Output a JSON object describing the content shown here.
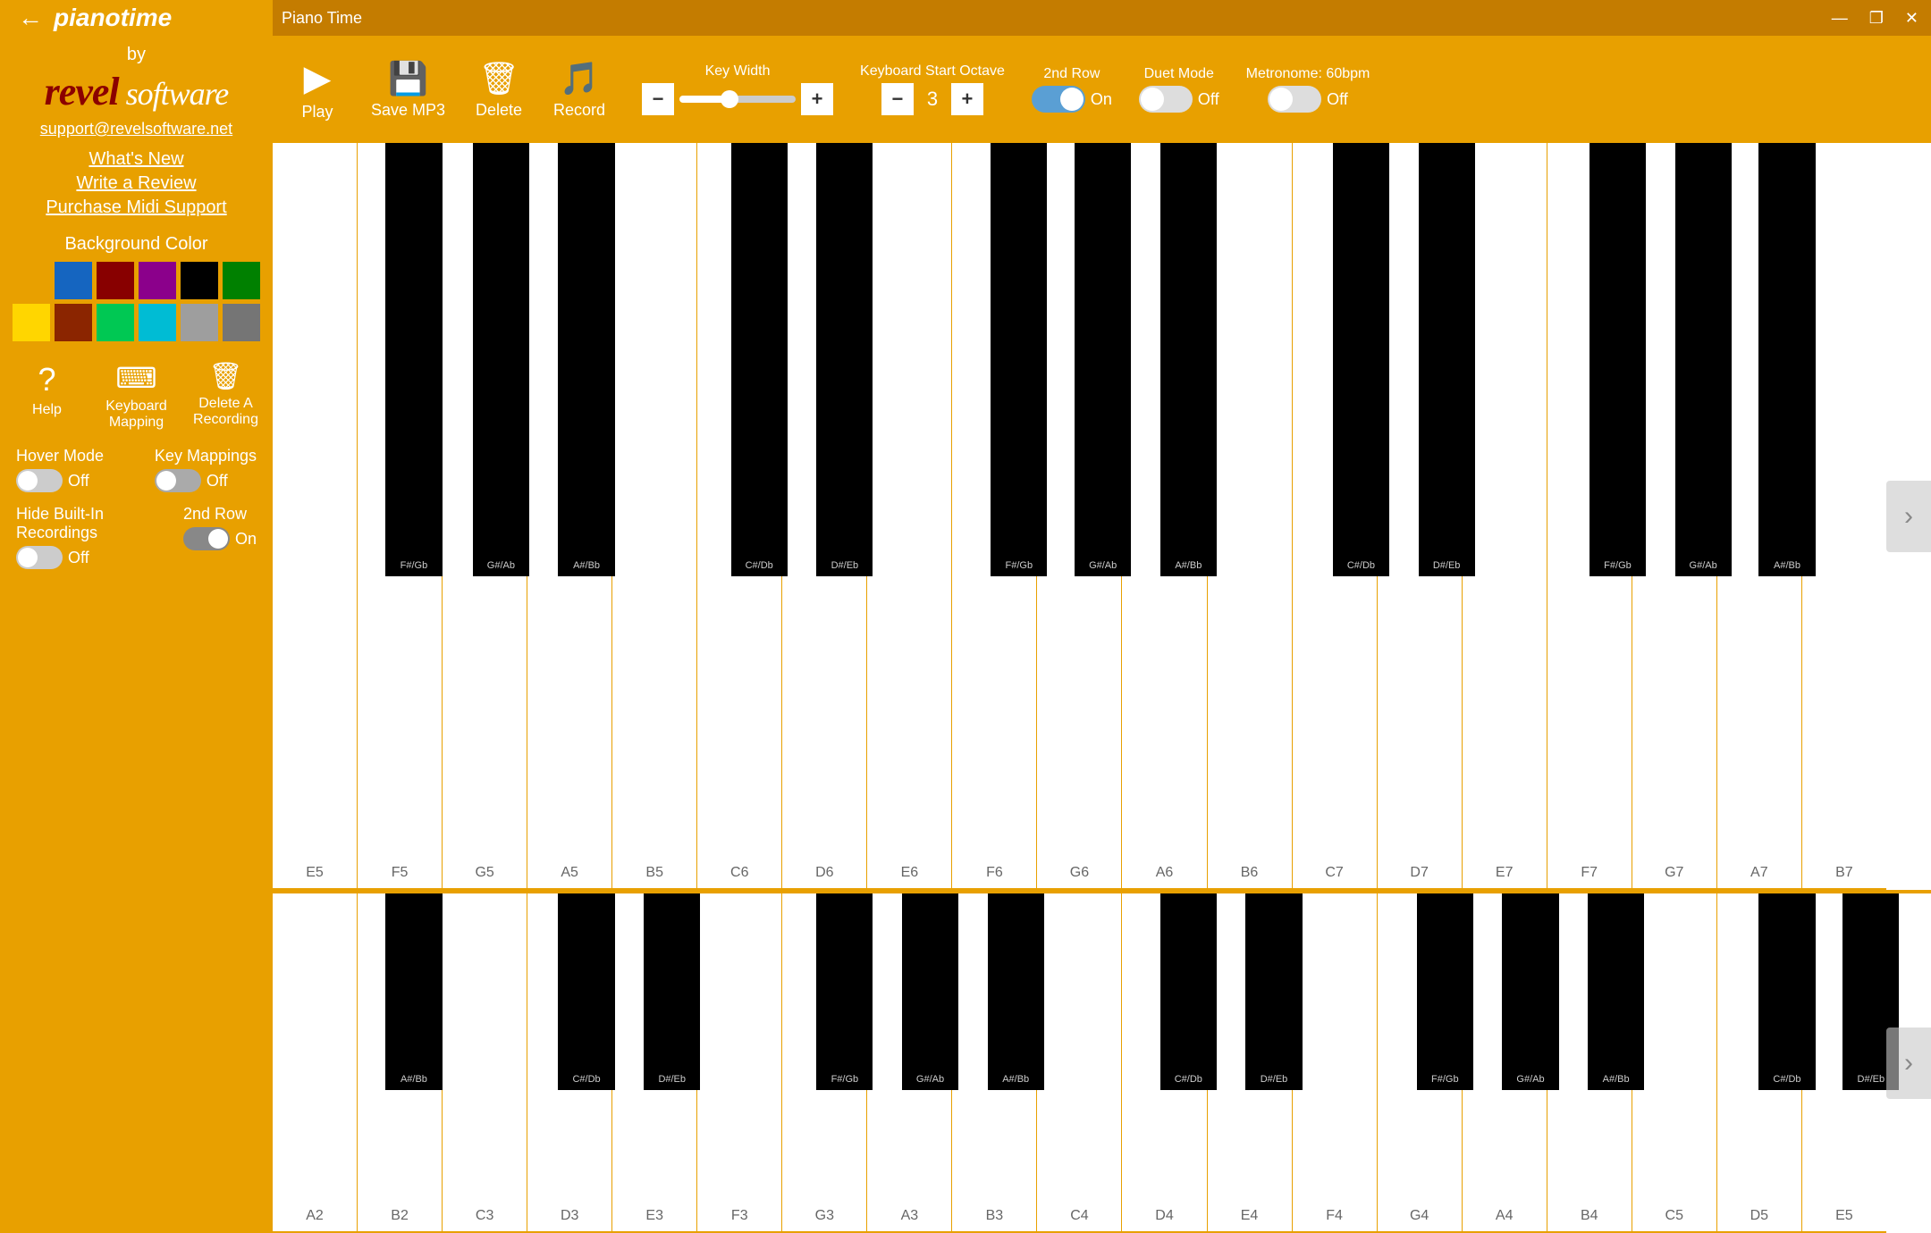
{
  "app": {
    "title": "Piano Time",
    "window_title": "Piano Time"
  },
  "window_controls": {
    "minimize": "—",
    "maximize": "❐",
    "close": "✕"
  },
  "sidebar": {
    "back_icon": "←",
    "app_name": "pianotime",
    "by_label": "by",
    "logo_revel": "revel",
    "logo_software": " software",
    "email": "support@revelsoftware.net",
    "links": [
      "What's New",
      "Write a Review",
      "Purchase Midi Support"
    ],
    "bg_color_label": "Background Color",
    "colors": [
      "#E8A000",
      "#1565C0",
      "#880000",
      "#8B008B",
      "#000000",
      "#008000",
      "#FFD600",
      "#8B2500",
      "#00C853",
      "#00BCD4",
      "#9E9E9E",
      "#757575"
    ],
    "tools": [
      {
        "id": "help",
        "icon": "?",
        "label": "Help"
      },
      {
        "id": "keyboard-mapping",
        "icon": "⌨",
        "label": "Keyboard\nMapping"
      },
      {
        "id": "delete-recording",
        "icon": "🗑",
        "label": "Delete A\nRecording"
      }
    ],
    "hover_mode_label": "Hover Mode",
    "hover_mode_state": "Off",
    "hover_mode_on": false,
    "key_mappings_label": "Key Mappings",
    "key_mappings_state": "Off",
    "key_mappings_on": false,
    "hide_recordings_label": "Hide Built-In Recordings",
    "hide_recordings_state": "Off",
    "hide_recordings_on": false,
    "second_row_label": "2nd Row",
    "second_row_state": "On",
    "second_row_on": true
  },
  "toolbar": {
    "play_label": "Play",
    "save_mp3_label": "Save MP3",
    "delete_label": "Delete",
    "record_label": "Record",
    "key_width_label": "Key Width",
    "key_width_min": "−",
    "key_width_max": "+",
    "keyboard_start_octave_label": "Keyboard Start Octave",
    "octave_minus": "−",
    "octave_value": "3",
    "octave_plus": "+",
    "second_row_label": "2nd Row",
    "second_row_state": "On",
    "second_row_on": true,
    "duet_mode_label": "Duet Mode",
    "duet_mode_state": "Off",
    "duet_mode_on": false,
    "metronome_label": "Metronome: 60bpm",
    "metronome_state": "Off",
    "metronome_on": false
  },
  "piano": {
    "top_row": {
      "white_keys": [
        "E5",
        "F5",
        "G5",
        "A5",
        "B5",
        "C6",
        "D6",
        "E6",
        "F6",
        "G6",
        "A6",
        "B6",
        "C7",
        "D7",
        "E7",
        "F7",
        "G7",
        "A7",
        "B7"
      ],
      "black_keys": [
        {
          "label": "F#/Gb",
          "pos_pct": 5.5
        },
        {
          "label": "G#/Ab",
          "pos_pct": 10.8
        },
        {
          "label": "A#/Bb",
          "pos_pct": 16.0
        },
        {
          "label": "C#/Db",
          "pos_pct": 26.5
        },
        {
          "label": "D#/Eb",
          "pos_pct": 31.7
        },
        {
          "label": "F#/Gb",
          "pos_pct": 42.1
        },
        {
          "label": "G#/Ab",
          "pos_pct": 47.4
        },
        {
          "label": "A#/Bb",
          "pos_pct": 52.6
        },
        {
          "label": "C#/Db",
          "pos_pct": 63.0
        },
        {
          "label": "D#/Eb",
          "pos_pct": 68.2
        },
        {
          "label": "F#/Gb",
          "pos_pct": 78.6
        },
        {
          "label": "G#/Ab",
          "pos_pct": 83.9
        },
        {
          "label": "A#/Bb",
          "pos_pct": 89.1
        }
      ]
    },
    "bottom_row": {
      "white_keys": [
        "A2",
        "B2",
        "C3",
        "D3",
        "E3",
        "F3",
        "G3",
        "A3",
        "B3",
        "C4",
        "D4",
        "E4",
        "F4",
        "G4",
        "A4",
        "B4",
        "C5",
        "D5",
        "E5"
      ],
      "black_keys": [
        {
          "label": "A#/Bb",
          "pos_pct": 5.5
        },
        {
          "label": "C#/Db",
          "pos_pct": 16.0
        },
        {
          "label": "D#/Eb",
          "pos_pct": 21.0
        },
        {
          "label": "F#/Gb",
          "pos_pct": 31.5
        },
        {
          "label": "G#/Ab",
          "pos_pct": 36.8
        },
        {
          "label": "A#/Bb",
          "pos_pct": 42.1
        },
        {
          "label": "C#/Db",
          "pos_pct": 52.5
        },
        {
          "label": "D#/Eb",
          "pos_pct": 57.9
        },
        {
          "label": "F#/Gb",
          "pos_pct": 68.4
        },
        {
          "label": "G#/Ab",
          "pos_pct": 73.7
        },
        {
          "label": "A#/Bb",
          "pos_pct": 79.0
        },
        {
          "label": "C#/Db",
          "pos_pct": 89.4
        },
        {
          "label": "D#/Eb",
          "pos_pct": 94.7
        }
      ]
    }
  }
}
